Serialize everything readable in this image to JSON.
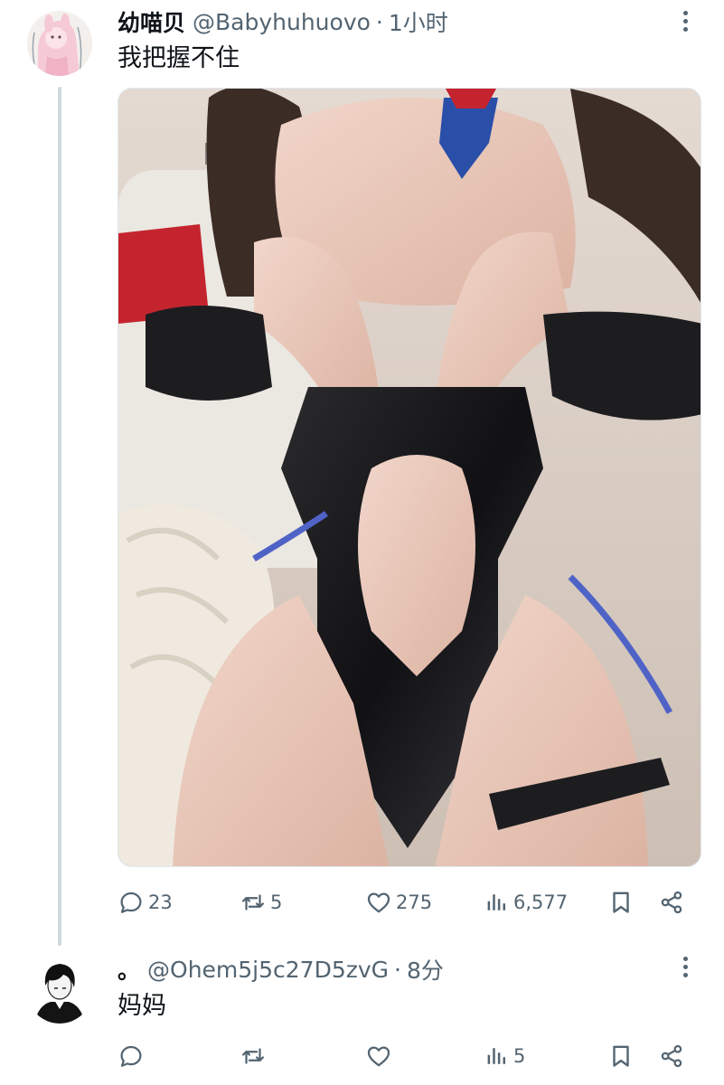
{
  "thread": [
    {
      "author": {
        "display_name": "幼喵贝",
        "handle": "@Babyhuhuovo",
        "time": "1小时"
      },
      "text": "我把握不住",
      "media": {
        "type": "photo"
      },
      "stats": {
        "replies": "23",
        "reposts": "5",
        "likes": "275",
        "views": "6,577"
      }
    },
    {
      "author": {
        "display_name": "。",
        "handle": "@Ohem5j5c27D5zvG",
        "time": "8分"
      },
      "text": "妈妈",
      "stats": {
        "replies": "",
        "reposts": "",
        "likes": "",
        "views": "5"
      }
    }
  ],
  "separator": "·",
  "icons": {
    "reply": "reply-icon",
    "repost": "repost-icon",
    "like": "heart-icon",
    "views": "views-icon",
    "bookmark": "bookmark-icon",
    "share": "share-icon",
    "more": "more-icon"
  },
  "colors": {
    "text_primary": "#0f1419",
    "text_secondary": "#536471",
    "thread_line": "#cfd9de"
  }
}
